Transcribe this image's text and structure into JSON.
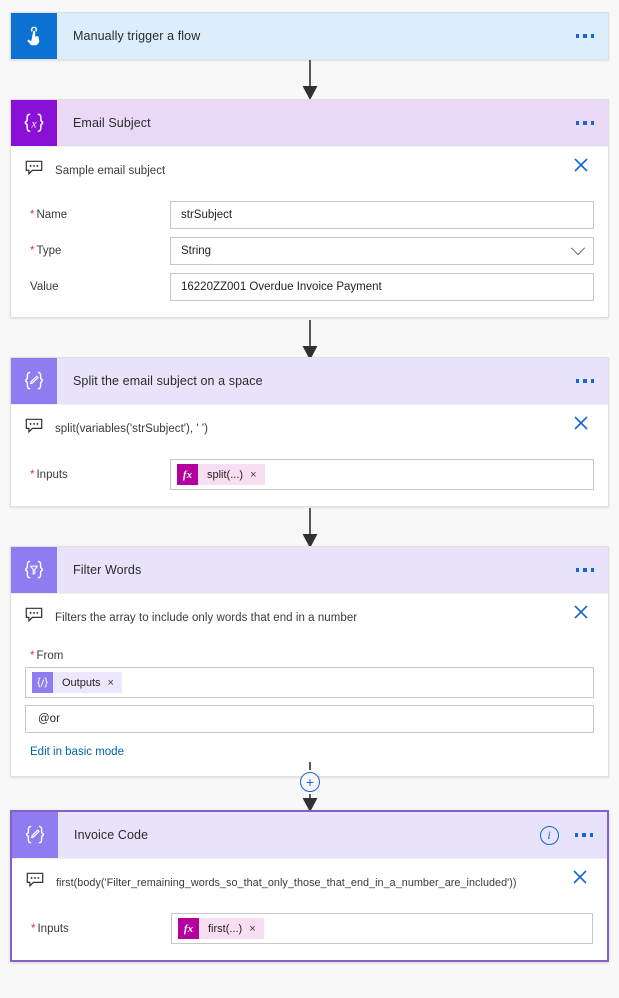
{
  "flow": {
    "nodes": [
      {
        "id": "trigger",
        "title": "Manually trigger a flow",
        "icon": "hand-tap-icon",
        "header_color": "#dceefb",
        "tile_color": "#0b72d4"
      },
      {
        "id": "email-subject",
        "title": "Email Subject",
        "icon": "variable-braces-icon",
        "header_color": "#e9d9f7",
        "tile_color": "#8a10d8",
        "comment": "Sample email subject",
        "fields": [
          {
            "label": "Name",
            "required": true,
            "value": "strSubject",
            "kind": "text"
          },
          {
            "label": "Type",
            "required": true,
            "value": "String",
            "kind": "select"
          },
          {
            "label": "Value",
            "required": false,
            "value": "16220ZZ001 Overdue Invoice Payment",
            "kind": "text"
          }
        ]
      },
      {
        "id": "split-subject",
        "title": "Split the email subject on a space",
        "icon": "compose-pencil-braces-icon",
        "header_color": "#e8e2fb",
        "tile_color": "#8e7cf0",
        "comment": "split(variables('strSubject'), ' ')",
        "inputs_label": "Inputs",
        "inputs_required": true,
        "token": {
          "kind": "fx",
          "glyph": "fx",
          "label": "split(...)"
        }
      },
      {
        "id": "filter-words",
        "title": "Filter Words",
        "icon": "filter-funnel-braces-icon",
        "header_color": "#e8e2fb",
        "tile_color": "#8e7cf0",
        "comment": "Filters the array to include only words that end in a number",
        "from_label": "From",
        "from_required": true,
        "from_token": {
          "kind": "outputs",
          "glyph": "{/}",
          "label": "Outputs"
        },
        "condition_value": "@or",
        "basic_mode_link": "Edit in basic mode"
      },
      {
        "id": "invoice-code",
        "title": "Invoice Code",
        "icon": "compose-pencil-braces-icon",
        "header_color": "#e8e2fb",
        "tile_color": "#8e7cf0",
        "selected": true,
        "info_icon": "info-circle-icon",
        "comment": "first(body('Filter_remaining_words_so_that_only_those_that_end_in_a_number_are_included'))",
        "inputs_label": "Inputs",
        "inputs_required": true,
        "token": {
          "kind": "fx",
          "glyph": "fx",
          "label": "first(...)"
        }
      }
    ],
    "common": {
      "more_commands_icon": "ellipsis-icon",
      "delete_icon": "close-x-icon",
      "comment_icon": "comment-bubble-icon",
      "add_step_icon": "plus-circle-icon",
      "add_step_label": "+",
      "chevron_icon": "chevron-down-icon",
      "required_marker": "*",
      "remove_token_icon": "close-x-small-icon",
      "remove_token_label": "×"
    },
    "colors": {
      "accent_blue": "#1565d8",
      "variable_purple": "#8a10d8",
      "action_violet": "#8e7cf0",
      "fx_magenta": "#b4009e",
      "link_blue": "#0063b1",
      "required_red": "#d03c3c",
      "canvas": "#f8f8f8"
    }
  }
}
